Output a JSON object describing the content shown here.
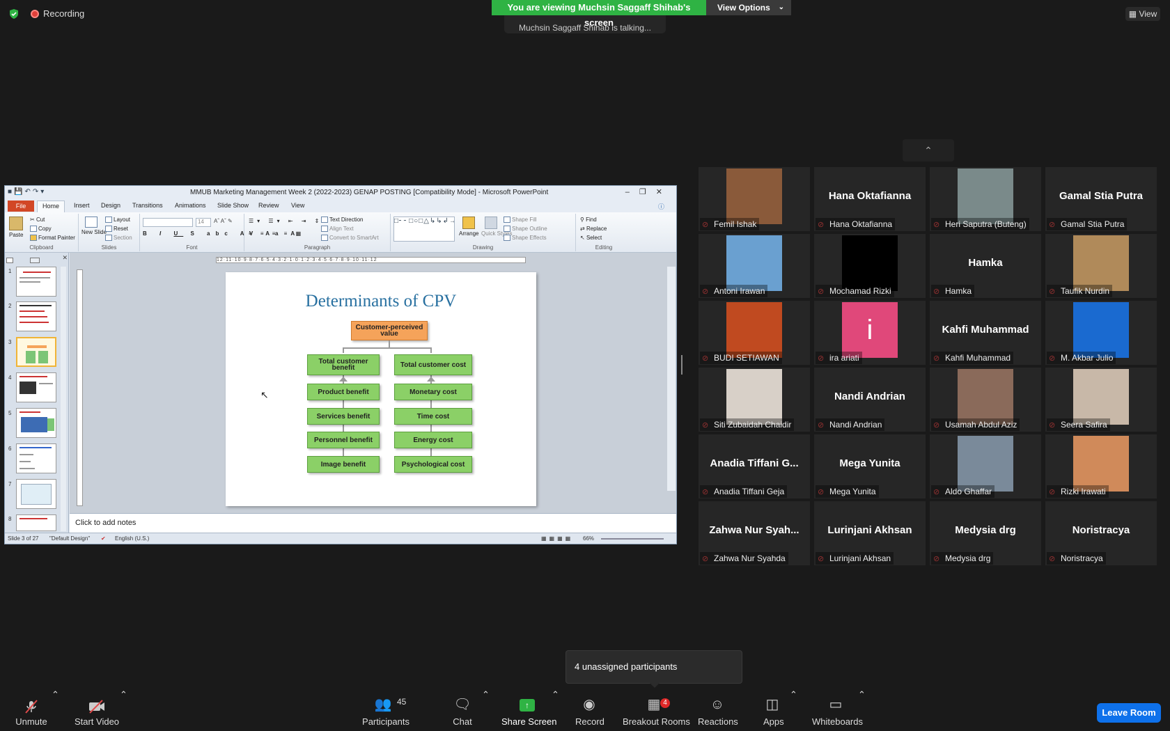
{
  "top": {
    "recording_label": "Recording",
    "viewing_banner": "You are viewing Muchsin Saggaff Shihab's screen",
    "view_options": "View Options",
    "talking": "Muchsin Saggaff Shihab is talking...",
    "view_button": "View"
  },
  "ppt": {
    "window_title": "MMUB Marketing Management Week 2 (2022-2023) GENAP POSTING [Compatibility Mode] - Microsoft PowerPoint",
    "tabs": [
      "File",
      "Home",
      "Insert",
      "Design",
      "Transitions",
      "Animations",
      "Slide Show",
      "Review",
      "View"
    ],
    "ribbon": {
      "paste": "Paste",
      "cut": "Cut",
      "copy": "Copy",
      "format_painter": "Format Painter",
      "clipboard": "Clipboard",
      "new_slide": "New Slide",
      "layout": "Layout",
      "reset": "Reset",
      "section": "Section",
      "slides": "Slides",
      "font_size": "14",
      "font": "Font",
      "text_direction": "Text Direction",
      "align_text": "Align Text",
      "convert_smartart": "Convert to SmartArt",
      "paragraph": "Paragraph",
      "arrange": "Arrange",
      "quick_styles": "Quick Styles",
      "shape_fill": "Shape Fill",
      "shape_outline": "Shape Outline",
      "shape_effects": "Shape Effects",
      "drawing": "Drawing",
      "find": "Find",
      "replace": "Replace",
      "select": "Select",
      "editing": "Editing"
    },
    "ruler_text": "12·11·10·9·8·7·6·5·4·3·2·1·0·1·2·3·4·5·6·7·8·9·10·11·12",
    "thumb_numbers": [
      "1",
      "2",
      "3",
      "4",
      "5",
      "6",
      "7",
      "8"
    ],
    "slide": {
      "title": "Determinants of CPV",
      "top_box": "Customer-perceived value",
      "left": [
        "Total customer benefit",
        "Product benefit",
        "Services benefit",
        "Personnel benefit",
        "Image benefit"
      ],
      "right": [
        "Total customer cost",
        "Monetary cost",
        "Time cost",
        "Energy cost",
        "Psychological cost"
      ]
    },
    "notes_placeholder": "Click to add notes",
    "status": {
      "slide": "Slide 3 of 27",
      "theme": "\"Default Design\"",
      "language": "English (U.S.)",
      "zoom": "66%"
    }
  },
  "participants": [
    {
      "name": "Femil Ishak",
      "display": "",
      "photo": "#8a5a3a"
    },
    {
      "name": "Hana Oktafianna",
      "display": "Hana Oktafianna",
      "photo": ""
    },
    {
      "name": "Heri Saputra (Buteng)",
      "display": "",
      "photo": "#7a8a8a"
    },
    {
      "name": "Gamal Stia Putra",
      "display": "Gamal Stia Putra",
      "photo": ""
    },
    {
      "name": "Antoni Irawan",
      "display": "",
      "photo": "#6aa0d0"
    },
    {
      "name": "Mochamad Rizki",
      "display": "",
      "photo": "#000000"
    },
    {
      "name": "Hamka",
      "display": "Hamka",
      "photo": ""
    },
    {
      "name": "Taufik Nurdin",
      "display": "",
      "photo": "#b08a5a"
    },
    {
      "name": "BUDI SETIAWAN",
      "display": "",
      "photo": "#c04a20"
    },
    {
      "name": "ira ariati",
      "display": "",
      "photo": "#e0487a",
      "initial": "i"
    },
    {
      "name": "Kahfi Muhammad",
      "display": "Kahfi Muhammad",
      "photo": ""
    },
    {
      "name": "M. Akbar Julio",
      "display": "",
      "photo": "#1a6ad0"
    },
    {
      "name": "Siti Zubaidah Chaidir",
      "display": "",
      "photo": "#d8d0c8"
    },
    {
      "name": "Nandi Andrian",
      "display": "Nandi Andrian",
      "photo": ""
    },
    {
      "name": "Usamah Abdul Aziz",
      "display": "",
      "photo": "#8a6a5a"
    },
    {
      "name": "Seera Safira",
      "display": "",
      "photo": "#c8b8a8"
    },
    {
      "name": "Anadia Tiffani Geja",
      "display": "Anadia Tiffani G...",
      "photo": ""
    },
    {
      "name": "Mega Yunita",
      "display": "Mega Yunita",
      "photo": ""
    },
    {
      "name": "Aldo Ghaffar",
      "display": "",
      "photo": "#7a8a9a"
    },
    {
      "name": "Rizki Irawati",
      "display": "",
      "photo": "#d08a5a"
    },
    {
      "name": "Zahwa Nur Syahda",
      "display": "Zahwa Nur Syah...",
      "photo": ""
    },
    {
      "name": "Lurinjani Akhsan",
      "display": "Lurinjani Akhsan",
      "photo": ""
    },
    {
      "name": "Medysia drg",
      "display": "Medysia drg",
      "photo": ""
    },
    {
      "name": "Noristracya",
      "display": "Noristracya",
      "photo": ""
    }
  ],
  "toast": "4 unassigned participants",
  "toolbar": {
    "unmute": "Unmute",
    "start_video": "Start Video",
    "participants": "Participants",
    "participants_count": "45",
    "chat": "Chat",
    "share_screen": "Share Screen",
    "record": "Record",
    "breakout_rooms": "Breakout Rooms",
    "breakout_badge": "4",
    "reactions": "Reactions",
    "apps": "Apps",
    "whiteboards": "Whiteboards",
    "leave_room": "Leave Room"
  },
  "colors": {
    "banner_green": "#2fb344",
    "leave_blue": "#0e71eb",
    "muted_red": "#e04a4a"
  }
}
